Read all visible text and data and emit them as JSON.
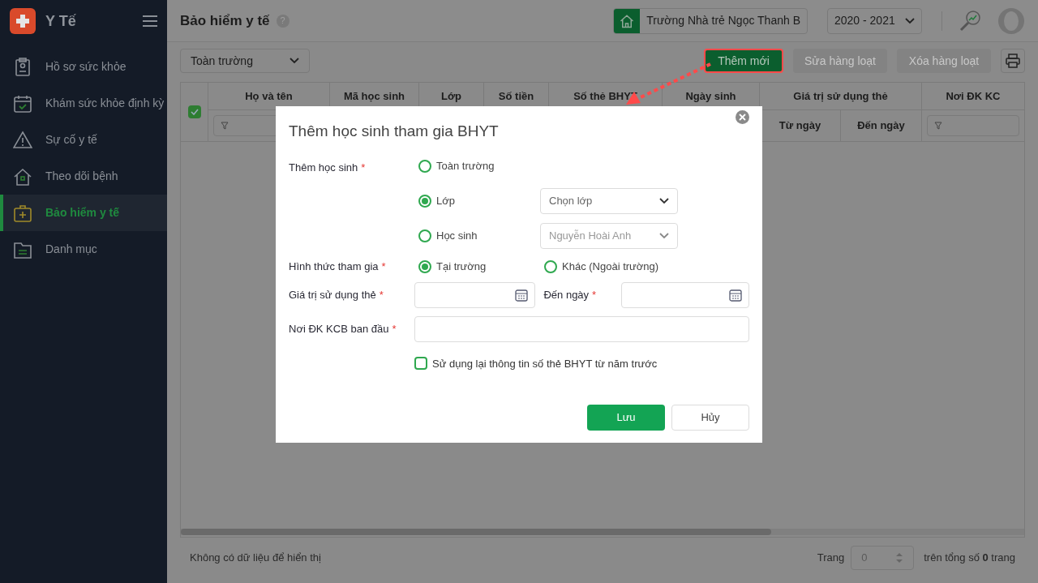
{
  "app": {
    "name": "Y Tế"
  },
  "sidebar": {
    "items": [
      {
        "label": "Hồ sơ sức khỏe",
        "selected": false
      },
      {
        "label": "Khám sức khỏe định kỳ",
        "selected": false
      },
      {
        "label": "Sự cố y tế",
        "selected": false
      },
      {
        "label": "Theo dõi bệnh",
        "selected": false
      },
      {
        "label": "Bảo hiểm y tế",
        "selected": true
      },
      {
        "label": "Danh mục",
        "selected": false
      }
    ]
  },
  "header": {
    "title": "Bảo hiểm y tế",
    "help": "?",
    "school": "Trường Nhà trẻ Ngọc Thanh B",
    "year": "2020 - 2021"
  },
  "toolbar": {
    "scope": "Toàn trường",
    "buttons": [
      {
        "label": "Thêm mới",
        "disabled": false,
        "highlighted": true
      },
      {
        "label": "Sửa hàng loạt",
        "disabled": true,
        "highlighted": false
      },
      {
        "label": "Xóa hàng loạt",
        "disabled": true,
        "highlighted": false
      }
    ]
  },
  "table": {
    "all_checked": true,
    "columns": [
      {
        "label": "Họ và tên"
      },
      {
        "label": "Mã học sinh"
      },
      {
        "label": "Lớp"
      },
      {
        "label": "Số tiền"
      },
      {
        "label": "Số thẻ BHYT"
      },
      {
        "label": "Ngày sinh"
      }
    ],
    "group": {
      "label": "Giá trị sử dụng thẻ",
      "sub": [
        "Từ ngày",
        "Đến ngày"
      ]
    },
    "last_column": {
      "label": "Nơi ĐK KC"
    }
  },
  "footer": {
    "message": "Không có dữ liệu để hiển thị",
    "page_label": "Trang",
    "page_value": "0",
    "total": "trên tổng số **0** trang"
  },
  "dialog": {
    "title": "Thêm học sinh tham gia BHYT",
    "add_label": "Thêm học sinh",
    "add_options": [
      {
        "label": "Toàn trường",
        "selected": false
      },
      {
        "label": "Lớp",
        "selected": true,
        "select": {
          "placeholder": "Chọn lớp",
          "disabled": false
        }
      },
      {
        "label": "Học sinh",
        "selected": false,
        "select": {
          "placeholder": "Nguyễn Hoài Anh",
          "disabled": true
        }
      }
    ],
    "mode_label": "Hình thức tham gia",
    "mode_options": [
      {
        "label": "Tại trường",
        "selected": true
      },
      {
        "label": "Khác (Ngoài trường)",
        "selected": false
      }
    ],
    "valid_label": "Giá trị sử dụng thẻ",
    "to_label": "Đến ngày",
    "place_label": "Nơi ĐK KCB ban đầu",
    "reuse": {
      "label": "Sử dụng lại thông tin số thẻ BHYT từ năm trước",
      "checked": false
    },
    "required": "*",
    "save": "Lưu",
    "cancel": "Hủy"
  }
}
